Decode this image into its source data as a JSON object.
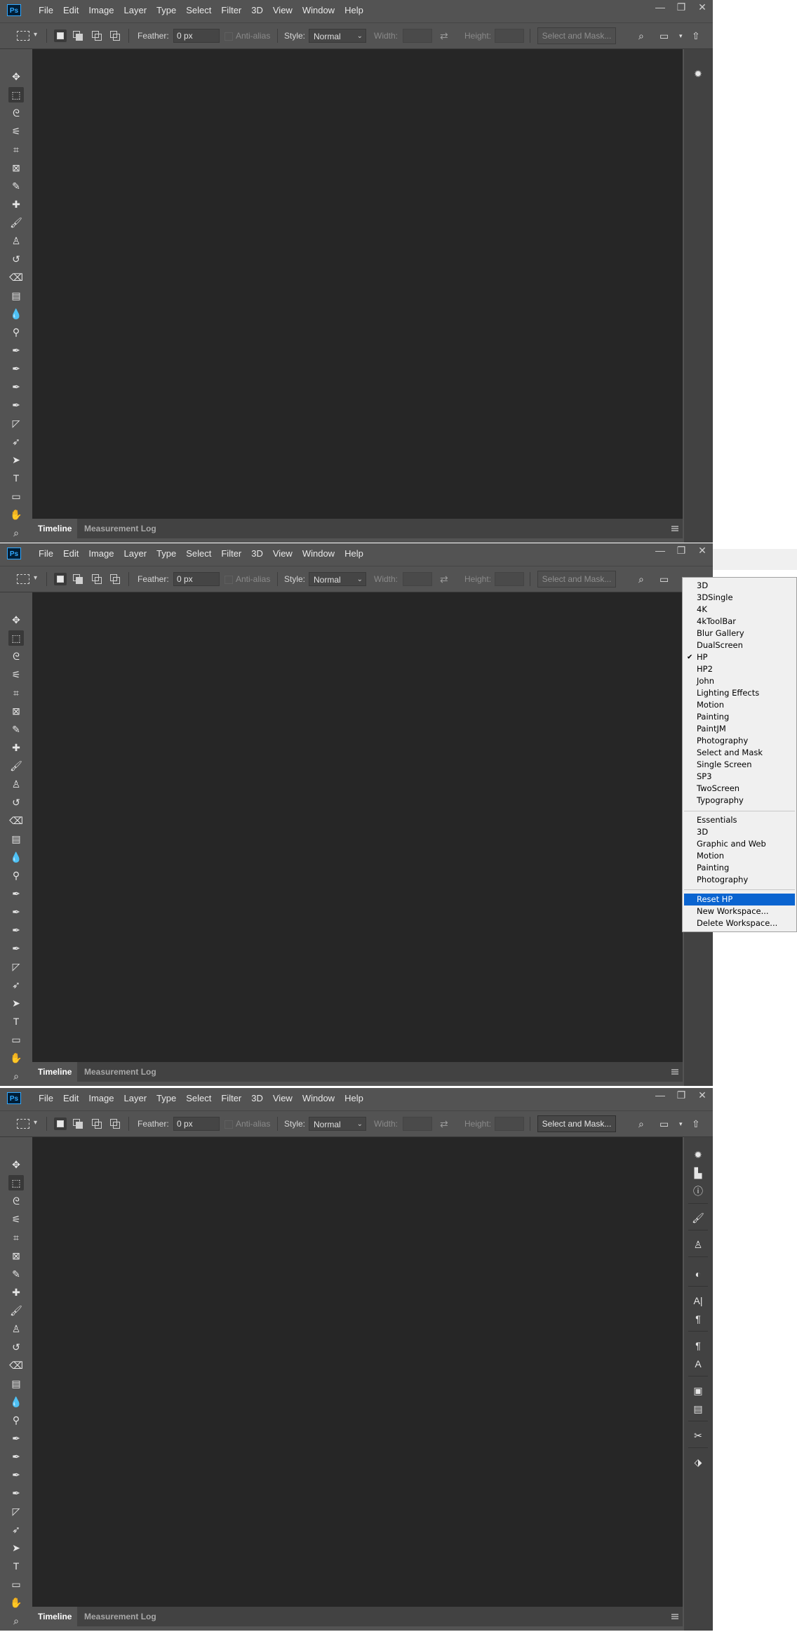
{
  "app": {
    "logo": "Ps",
    "menu": [
      "File",
      "Edit",
      "Image",
      "Layer",
      "Type",
      "Select",
      "Filter",
      "3D",
      "View",
      "Window",
      "Help"
    ],
    "window_buttons": {
      "minimize": "—",
      "restore": "❐",
      "close": "✕"
    }
  },
  "options_bar": {
    "feather_label": "Feather:",
    "feather_value": "0 px",
    "antialias_label": "Anti-alias",
    "style_label": "Style:",
    "style_value": "Normal",
    "width_label": "Width:",
    "height_label": "Height:",
    "select_mask_label": "Select and Mask..."
  },
  "bottom_tabs": [
    "Timeline",
    "Measurement Log"
  ],
  "tools": [
    "move",
    "rectangular-marquee",
    "lasso",
    "magic-wand",
    "crop",
    "frame",
    "eyedropper",
    "healing-brush",
    "brush",
    "clone-stamp",
    "history-brush",
    "eraser",
    "gradient",
    "blur",
    "dodge",
    "pen",
    "pen-curvature",
    "pen-freeform",
    "pen-content-aware",
    "path-select",
    "direct-select",
    "select-arrow",
    "type",
    "shape",
    "hand",
    "zoom"
  ],
  "workspace_menu": {
    "custom": [
      "3D",
      "3DSingle",
      "4K",
      "4kToolBar",
      "Blur Gallery",
      "DualScreen",
      "HP",
      "HP2",
      "John",
      "Lighting Effects",
      "Motion",
      "Painting",
      "PaintJM",
      "Photography",
      "Select and Mask",
      "Single Screen",
      "SP3",
      "TwoScreen",
      "Typography"
    ],
    "checked": "HP",
    "builtin": [
      "Essentials",
      "3D",
      "Graphic and Web",
      "Motion",
      "Painting",
      "Photography"
    ],
    "actions": [
      "Reset HP",
      "New Workspace...",
      "Delete Workspace..."
    ],
    "highlighted": "Reset HP"
  },
  "colors": {
    "ui_bg": "#535353",
    "canvas": "#262626",
    "panel": "#424242",
    "menu_highlight": "#0a64d0"
  }
}
